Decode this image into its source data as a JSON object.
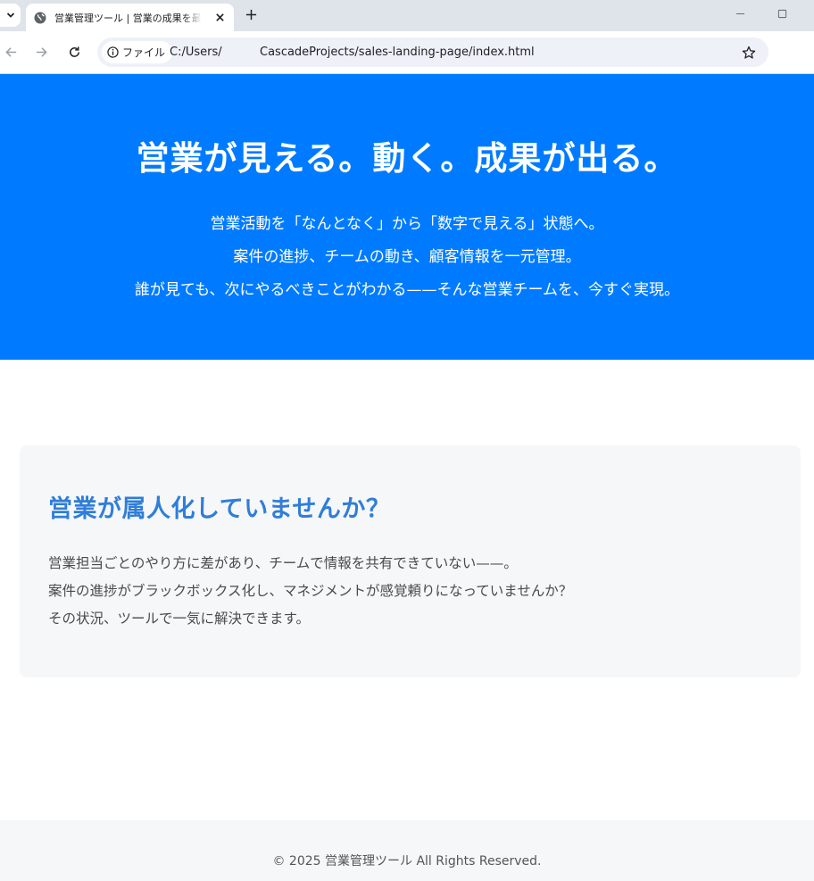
{
  "browser": {
    "tab": {
      "title": "営業管理ツール | 営業の成果を最大化"
    },
    "address_bar": {
      "site_chip_label": "ファイル",
      "url_prefix": "C:/Users/",
      "url_suffix": "CascadeProjects/sales-landing-page/index.html"
    }
  },
  "hero": {
    "title": "営業が見える。動く。成果が出る。",
    "lead_lines": [
      "営業活動を「なんとなく」から「数字で見える」状態へ。",
      "案件の進捗、チームの動き、顧客情報を一元管理。",
      "誰が見ても、次にやるべきことがわかる——そんな営業チームを、今すぐ実現。"
    ]
  },
  "problem": {
    "title": "営業が属人化していませんか？",
    "body_lines": [
      "営業担当ごとのやり方に差があり、チームで情報を共有できていない——。",
      "案件の進捗がブラックボックス化し、マネジメントが感覚頼りになっていませんか？",
      "その状況、ツールで一気に解決できます。"
    ]
  },
  "footer": {
    "copyright": "© 2025 営業管理ツール All Rights Reserved."
  },
  "colors": {
    "hero_background": "#007bff",
    "problem_title": "#2f7ed8",
    "card_background": "#f6f7f9",
    "tabstrip_background": "#dfe3ea"
  },
  "icons": {
    "tab_menu": "chevron-down-icon",
    "favicon": "globe-icon",
    "tab_close": "close-icon",
    "new_tab": "plus-icon",
    "minimize": "minimize-icon",
    "maximize": "maximize-icon",
    "back": "arrow-left-icon",
    "forward": "arrow-right-icon",
    "reload": "reload-icon",
    "site_info": "info-icon",
    "bookmark": "star-icon"
  }
}
